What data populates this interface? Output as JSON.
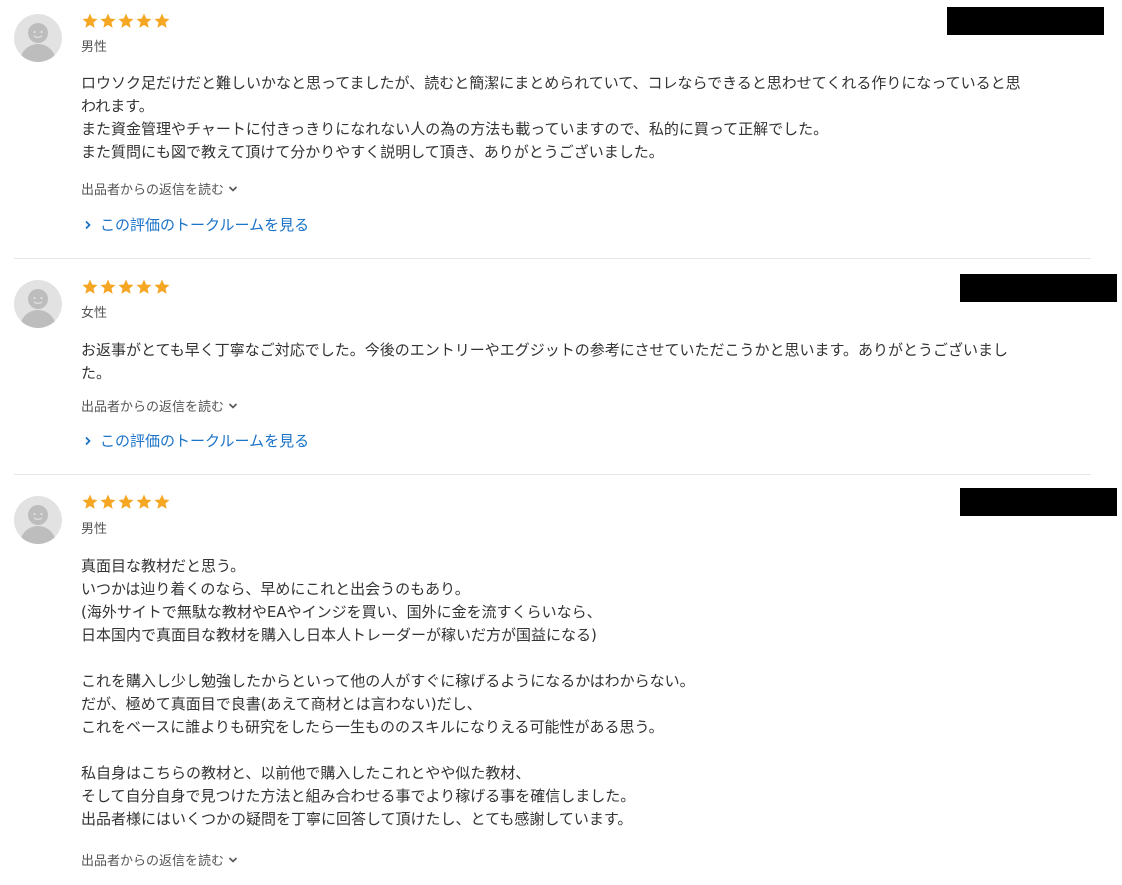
{
  "colors": {
    "star": "#f5a623",
    "link": "#1a73c8",
    "avatar_bg": "#e2e2e2",
    "avatar_fg": "#ffffff",
    "redaction": "#000000"
  },
  "reviews": [
    {
      "rating": 5,
      "gender": "男性",
      "body": "ロウソク足だけだと難しいかなと思ってましたが、読むと簡潔にまとめられていて、コレならできると思わせてくれる作りになっていると思\nわれます。\nまた資金管理やチャートに付きっきりになれない人の為の方法も載っていますので、私的に買って正解でした。\nまた質問にも図で教えて頂けて分かりやすく説明して頂き、ありがとうございました。",
      "reply_label": "出品者からの返信を読む",
      "talk_label": "この評価のトークルームを見る"
    },
    {
      "rating": 5,
      "gender": "女性",
      "body": "お返事がとても早く丁寧なご対応でした。今後のエントリーやエグジットの参考にさせていただこうかと思います。ありがとうございまし\nた。",
      "reply_label": "出品者からの返信を読む",
      "talk_label": "この評価のトークルームを見る"
    },
    {
      "rating": 5,
      "gender": "男性",
      "body": "真面目な教材だと思う。\nいつかは辿り着くのなら、早めにこれと出会うのもあり。\n(海外サイトで無駄な教材やEAやインジを買い、国外に金を流すくらいなら、\n日本国内で真面目な教材を購入し日本人トレーダーが稼いだ方が国益になる)\n\nこれを購入し少し勉強したからといって他の人がすぐに稼げるようになるかはわからない。\nだが、極めて真面目で良書(あえて商材とは言わない)だし、\nこれをベースに誰よりも研究をしたら一生もののスキルになりえる可能性がある思う。\n\n私自身はこちらの教材と、以前他で購入したこれとやや似た教材、\nそして自分自身で見つけた方法と組み合わせる事でより稼げる事を確信しました。\n出品者様にはいくつかの疑問を丁寧に回答して頂けたし、とても感謝しています。",
      "reply_label": "出品者からの返信を読む"
    }
  ]
}
